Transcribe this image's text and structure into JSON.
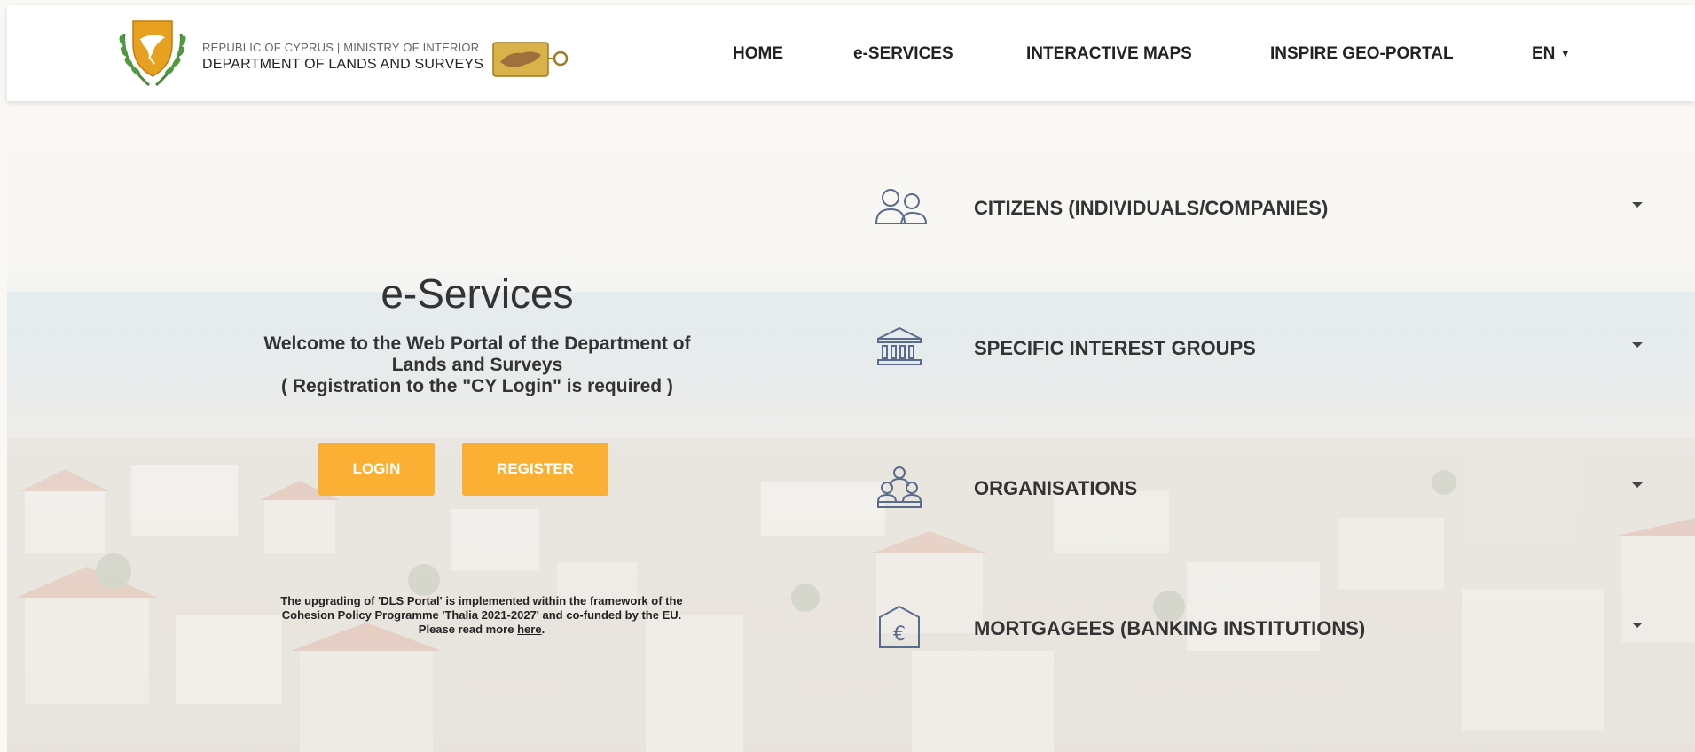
{
  "header": {
    "logo_line1": "REPUBLIC OF CYPRUS | MINISTRY OF INTERIOR",
    "logo_line2": "DEPARTMENT OF LANDS AND SURVEYS",
    "nav": [
      {
        "label": "HOME"
      },
      {
        "label": "e-SERVICES"
      },
      {
        "label": "INTERACTIVE MAPS"
      },
      {
        "label": "INSPIRE GEO-PORTAL"
      }
    ],
    "lang": "EN"
  },
  "hero": {
    "title": "e-Services",
    "welcome_line1": "Welcome to the Web Portal of the Department of",
    "welcome_line2": "Lands and Surveys",
    "welcome_line3": "( Registration to the \"CY Login\" is required )",
    "login_label": "LOGIN",
    "register_label": "REGISTER",
    "funding_line1": "The upgrading of 'DLS Portal' is implemented within the framework of the",
    "funding_line2": "Cohesion Policy Programme 'Thalia 2021-2027' and co-funded by the EU.",
    "funding_line3_prefix": "Please read more ",
    "funding_link": "here",
    "funding_line3_suffix": "."
  },
  "accordion": [
    {
      "label": "CITIZENS (INDIVIDUALS/COMPANIES)",
      "icon": "citizens-icon"
    },
    {
      "label": "SPECIFIC INTEREST GROUPS",
      "icon": "institution-icon"
    },
    {
      "label": "ORGANISATIONS",
      "icon": "organisations-icon"
    },
    {
      "label": "MORTGAGEES (BANKING INSTITUTIONS)",
      "icon": "euro-bank-icon"
    }
  ],
  "colors": {
    "accent": "#fbb034",
    "icon_stroke": "#5a6b8c"
  }
}
